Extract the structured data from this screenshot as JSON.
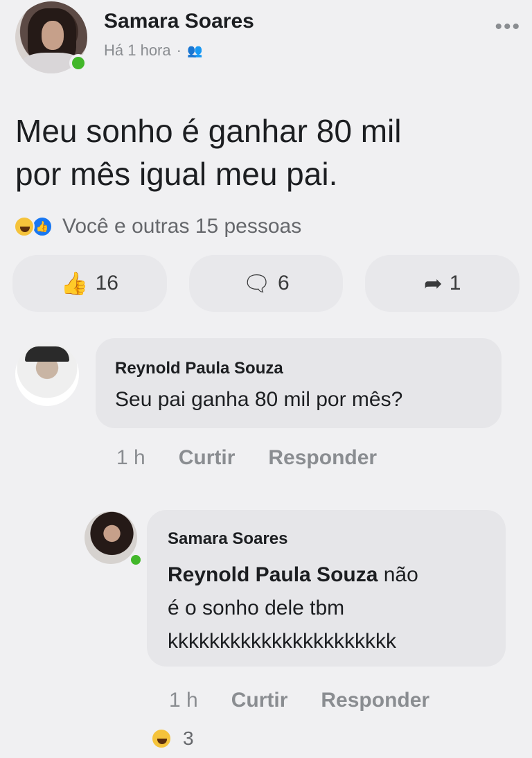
{
  "post": {
    "author": "Samara Soares",
    "time": "Há 1 hora",
    "privacy_icon": "friends-icon",
    "text_line1": "Meu sonho é ganhar 80 mil",
    "text_line2": "por mês igual meu pai.",
    "reactions_text": "Você e outras 15 pessoas"
  },
  "actions": {
    "likes": "16",
    "comments": "6",
    "shares": "1"
  },
  "comments": [
    {
      "author": "Reynold Paula Souza",
      "text": "Seu pai ganha 80 mil por mês?",
      "time": "1 h",
      "like_label": "Curtir",
      "reply_label": "Responder"
    },
    {
      "author": "Samara Soares",
      "mention": "Reynold Paula Souza",
      "text_after_mention": "não",
      "text_line2": "é o sonho dele tbm",
      "text_line3": "kkkkkkkkkkkkkkkkkkkkkk",
      "time": "1 h",
      "like_label": "Curtir",
      "reply_label": "Responder",
      "reaction_count": "3"
    }
  ]
}
